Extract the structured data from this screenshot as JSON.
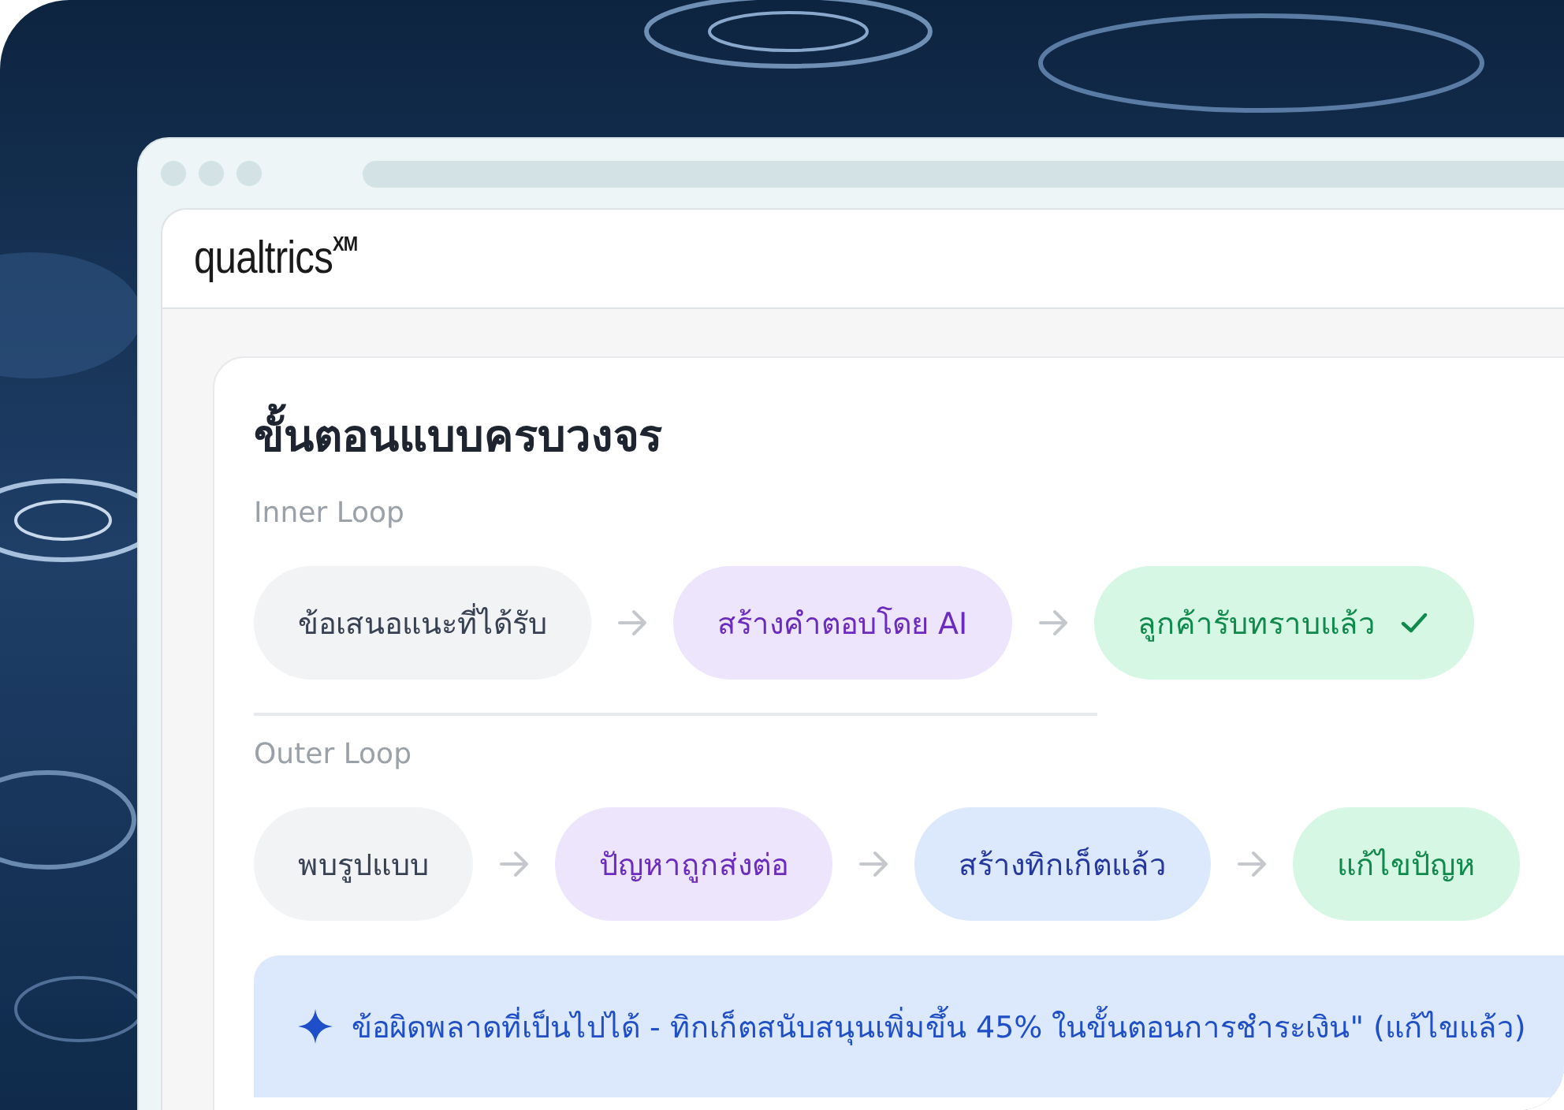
{
  "app": {
    "logo": "qualtrics",
    "logo_mark": "XM"
  },
  "card": {
    "title": "ขั้นตอนแบบครบวงจร",
    "loops": [
      {
        "label": "Inner Loop",
        "steps": [
          {
            "label": "ข้อเสนอแนะที่ได้รับ",
            "kind": "neutral",
            "done": false
          },
          {
            "label": "สร้างคำตอบโดย AI",
            "kind": "purple",
            "done": false
          },
          {
            "label": "ลูกค้ารับทราบแล้ว",
            "kind": "green",
            "done": true
          }
        ]
      },
      {
        "label": "Outer Loop",
        "steps": [
          {
            "label": "พบรูปแบบ",
            "kind": "neutral",
            "done": false
          },
          {
            "label": "ปัญหาถูกส่งต่อ",
            "kind": "purple",
            "done": false
          },
          {
            "label": "สร้างทิกเก็ตแล้ว",
            "kind": "blue",
            "done": false
          },
          {
            "label": "แก้ไขปัญห",
            "kind": "green",
            "done": false
          }
        ]
      }
    ],
    "insight": "ข้อผิดพลาดที่เป็นไปได้ - ทิกเก็ตสนับสนุนเพิ่มขึ้น 45% ในขั้นตอนการชำระเงิน\" (แก้ไขแล้ว)"
  }
}
